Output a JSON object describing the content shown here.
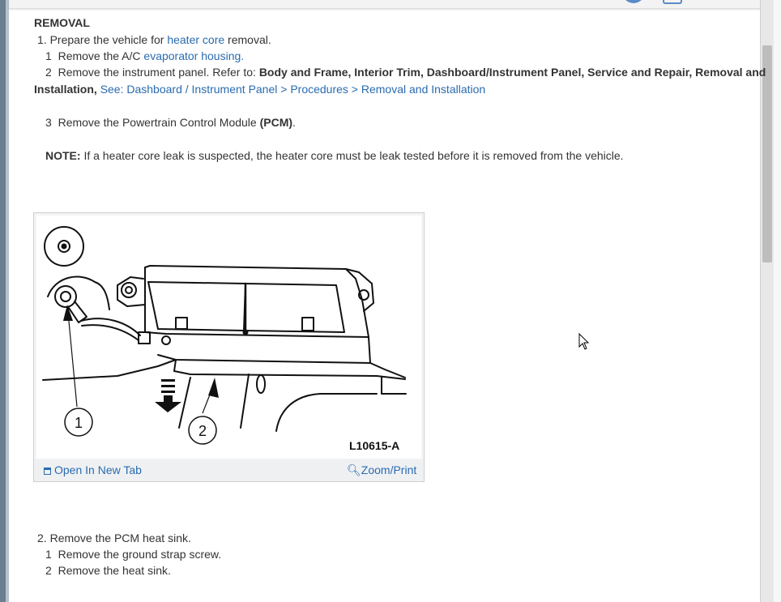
{
  "section_title": "REMOVAL",
  "step1": {
    "num": "1.",
    "pre": "Prepare the vehicle for",
    "link": "heater core",
    "post": "removal."
  },
  "sub1": {
    "num": "1",
    "pre": "Remove the A/C",
    "link": "evaporator housing."
  },
  "sub2": {
    "num": "2",
    "pre": "Remove the instrument panel. Refer to:",
    "bold": "Body and Frame, Interior Trim, Dashboard/Instrument Panel, Service and Repair, Removal and",
    "bold2": "Installation,",
    "link": "See: Dashboard / Instrument Panel > Procedures > Removal and Installation"
  },
  "sub3": {
    "num": "3",
    "pre": "Remove the Powertrain Control Module",
    "bold": "(PCM)",
    "post": "."
  },
  "note": {
    "label": "NOTE:",
    "text": "If a heater core leak is suspected, the heater core must be leak tested before it is removed from the vehicle."
  },
  "figure": {
    "code": "L10615-A",
    "callout1": "1",
    "callout2": "2",
    "open_tab": "Open In New Tab",
    "zoom": "Zoom/Print"
  },
  "step2": {
    "num": "2.",
    "text": "Remove the PCM heat sink."
  },
  "step2_sub1": {
    "num": "1",
    "text": "Remove the ground strap screw."
  },
  "step2_sub2": {
    "num": "2",
    "text": "Remove the heat sink."
  },
  "colors": {
    "link": "#2a6bb0",
    "text": "#333333",
    "accent": "#5b8bc7"
  }
}
